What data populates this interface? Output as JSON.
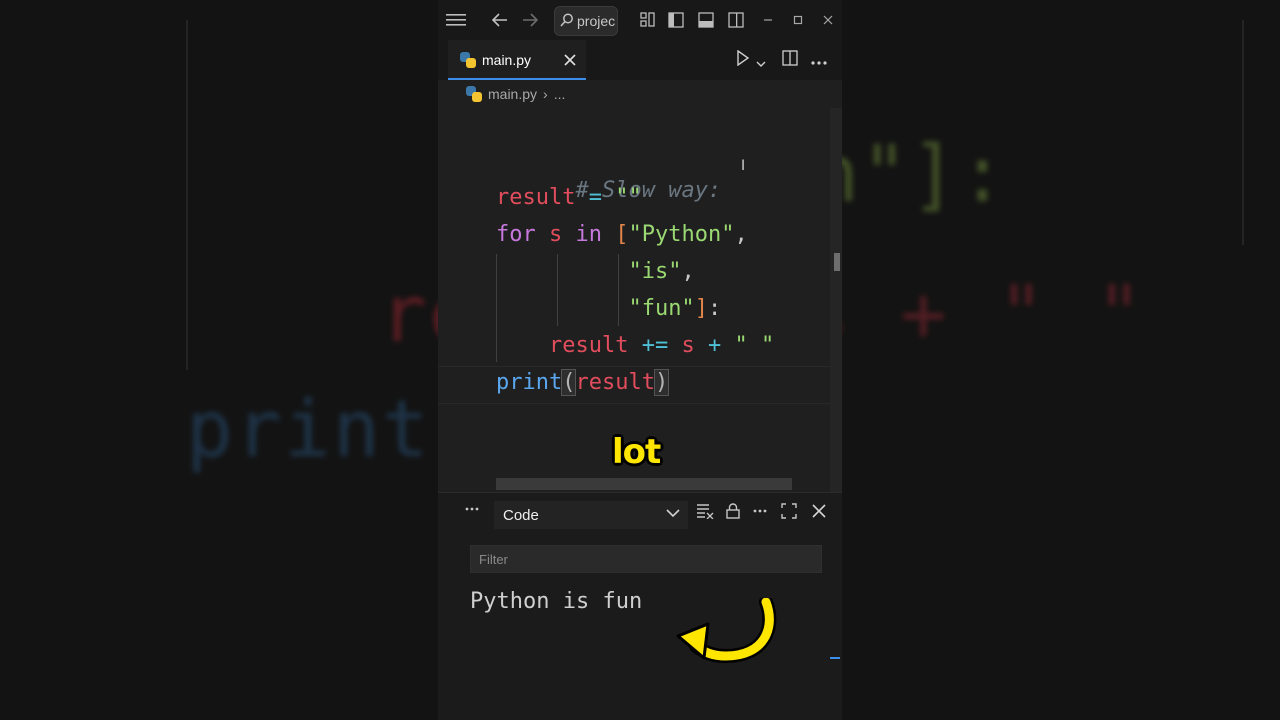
{
  "background": {
    "left_text": "print",
    "left_text_top": "re",
    "right_text_top": "n\"]:",
    "right_text_mid": "s + \" \""
  },
  "titlebar": {
    "menu_icon": "menu-icon",
    "back_icon": "arrow-left-icon",
    "forward_icon": "arrow-right-icon",
    "search_value": "projec",
    "layout_icons": [
      "customize-layout-icon",
      "toggle-primary-sidebar-icon",
      "toggle-panel-icon",
      "toggle-secondary-sidebar-icon"
    ],
    "window_controls": [
      "minimize-icon",
      "maximize-icon",
      "close-icon"
    ]
  },
  "tab": {
    "filename": "main.py",
    "active": true
  },
  "breadcrumb": {
    "file": "main.py",
    "more": "..."
  },
  "editor": {
    "language": "python",
    "lines": [
      "# Slow way:",
      "result = \"\"",
      "for s in [\"Python\",",
      "          \"is\",",
      "          \"fun\"]:",
      "    result += s + \" \"",
      "print(result)"
    ],
    "tokens": {
      "comment": "# Slow way:",
      "result": "result",
      "eq": "=",
      "empty_str": "\"\"",
      "for": "for",
      "s": "s",
      "in": "in",
      "lbracket": "[",
      "python_str": "\"Python\"",
      "comma": ",",
      "is_str": "\"is\"",
      "fun_str": "\"fun\"",
      "rbracket": "]",
      "colon": ":",
      "plus_eq": "+=",
      "plus": "+",
      "space_str": "\" \"",
      "print": "print",
      "lparen": "(",
      "rparen": ")"
    }
  },
  "panel": {
    "more_icon": "ellipsis-icon",
    "output_channel": "Code",
    "filter_placeholder": "Filter",
    "output": "Python is fun",
    "actions": [
      "clear-output-icon",
      "lock-scroll-icon",
      "more-actions-icon",
      "maximize-panel-icon",
      "close-panel-icon"
    ]
  },
  "caption": "lot",
  "colors": {
    "accent": "#3b8eea",
    "caption_yellow": "#ffe600",
    "keyword": "#c678dd",
    "variable": "#e24d5d",
    "string": "#9ad872",
    "function": "#5aa7ef",
    "operator": "#4fc1d6",
    "bracket": "#e0844a"
  }
}
